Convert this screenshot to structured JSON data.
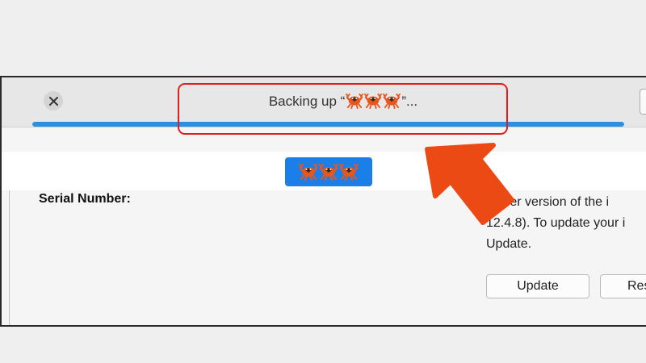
{
  "window": {
    "status_text_prefix": "Backing up “",
    "status_text_suffix": "”...",
    "progress_fraction": 1.0,
    "device_name_icon": "crab-emoji-icon",
    "device_name_icon_count": 3
  },
  "summary": {
    "serial_label": "Serial Number:",
    "update_message": "newer version of the i\n12.4.8). To update your i\nUpdate.",
    "update_button_label": "Update",
    "restore_button_label": "Res"
  },
  "annotation": {
    "highlight_color": "#e01e1e",
    "arrow_color": "#ec4a14"
  },
  "colors": {
    "progress": "#2b8fe3",
    "device_pill": "#1a7fe8",
    "emoji_fill": "#e8561c"
  }
}
